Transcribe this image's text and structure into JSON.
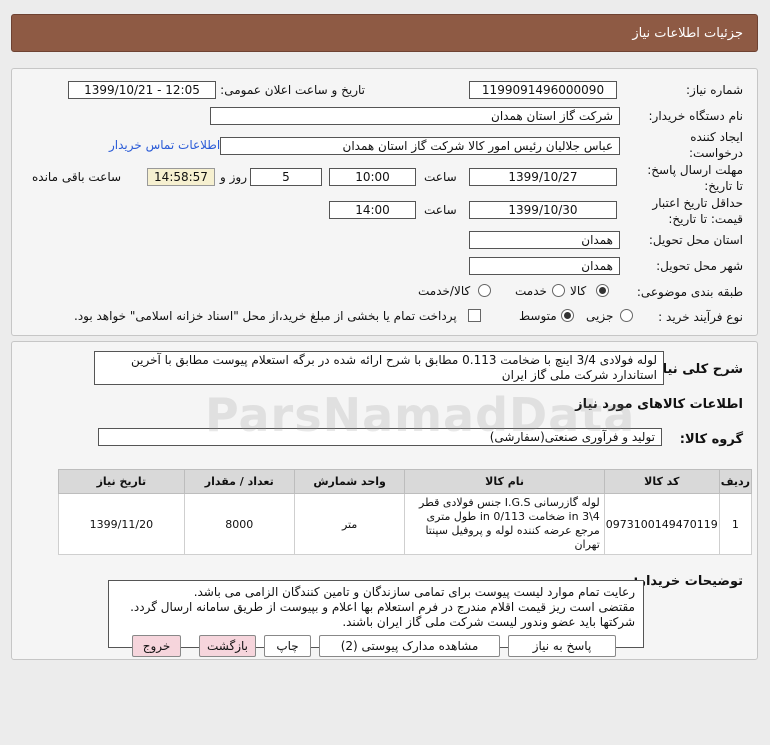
{
  "header": {
    "title": "جزئیات اطلاعات نیاز"
  },
  "info": {
    "need_number_label": "شماره نیاز:",
    "need_number": "1199091496000090",
    "announce_label": "تاریخ و ساعت اعلان عمومی:",
    "announce_value": "1399/10/21 - 12:05",
    "buyer_org_label": "نام دستگاه خریدار:",
    "buyer_org": "شرکت گاز استان همدان",
    "creator_label_1": "ایجاد کننده",
    "creator_label_2": "درخواست:",
    "creator": "عباس جلالیان رئیس امور کالا شرکت گاز استان همدان",
    "contact_link": "اطلاعات تماس خریدار",
    "deadline_label_1": "مهلت ارسال پاسخ:",
    "deadline_label_2": "تا تاریخ:",
    "deadline_date": "1399/10/27",
    "time_label": "ساعت",
    "deadline_time": "10:00",
    "days_value": "5",
    "days_label": "روز و",
    "remaining_time": "14:58:57",
    "remaining_label": "ساعت باقی مانده",
    "validity_label_1": "حداقل تاریخ اعتبار",
    "validity_label_2": "قیمت: تا تاریخ:",
    "validity_date": "1399/10/30",
    "validity_time_label": "ساعت",
    "validity_time": "14:00",
    "province_label": "استان محل تحویل:",
    "province": "همدان",
    "city_label": "شهر محل تحویل:",
    "city": "همدان",
    "category_label": "طبقه بندی موضوعی:",
    "category_options": [
      "کالا",
      "خدمت",
      "کالا/خدمت"
    ],
    "process_label": "نوع فرآیند خرید :",
    "process_options": [
      "جزیی",
      "متوسط"
    ],
    "payment_note": "پرداخت تمام یا بخشی از مبلغ خرید،از محل \"اسناد خزانه اسلامی\" خواهد بود."
  },
  "description": {
    "label": "شرح کلی نیاز:",
    "text": "لوله فولادی 3/4 اینچ با ضخامت 0.113  مطابق با شرح ارائه شده در برگه استعلام پیوست مطابق با آخرین استاندارد شرکت ملی گاز ایران"
  },
  "goods": {
    "section_title": "اطلاعات کالاهای مورد نیاز",
    "group_label": "گروه کالا:",
    "group_value": "تولید و فرآوری صنعتی(سفارشی)",
    "columns": [
      "ردیف",
      "کد کالا",
      "نام کالا",
      "واحد شمارش",
      "تعداد / مقدار",
      "تاریخ نیاز"
    ],
    "rows": [
      {
        "row": "1",
        "code": "0973100149470119",
        "name": "لوله گازرسانی I.G.S جنس فولادی قطر 4\\3 in ضخامت 0/113 in طول متری مرجع عرضه کننده لوله و پروفیل سپنتا تهران",
        "unit": "متر",
        "qty": "8000",
        "date": "1399/11/20"
      }
    ]
  },
  "buyer_notes": {
    "label": "توضیحات خریدار:",
    "lines": [
      "رعایت تمام موارد لیست پیوست برای تمامی سازندگان و تامین کنندگان الزامی می باشد.",
      "مقتضی است ریز قیمت اقلام مندرج در فرم استعلام بها اعلام و بپیوست از طریق سامانه ارسال گردد.",
      "شرکتها باید عضو وندور لیست شرکت ملی گاز  ایران باشند."
    ]
  },
  "actions": {
    "reply": "پاسخ به نیاز",
    "attachments": "مشاهده مدارک پیوستی (2)",
    "print": "چاپ",
    "back": "بازگشت",
    "exit": "خروج"
  }
}
